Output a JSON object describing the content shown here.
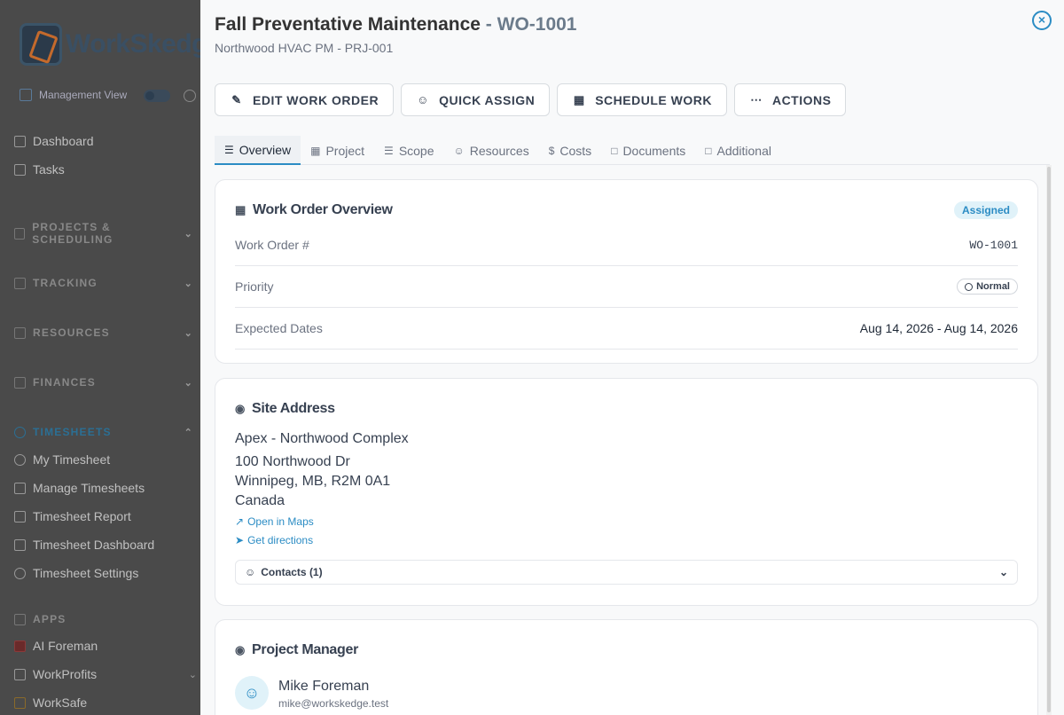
{
  "sidebar": {
    "logo_text": "WorkSkedge",
    "management_view": "Management View",
    "top_items": [
      {
        "label": "Dashboard"
      },
      {
        "label": "Tasks"
      }
    ],
    "sections": [
      {
        "label": "PROJECTS & SCHEDULING"
      },
      {
        "label": "TRACKING"
      },
      {
        "label": "RESOURCES"
      },
      {
        "label": "FINANCES"
      },
      {
        "label": "TIMESHEETS"
      }
    ],
    "timesheet_items": [
      {
        "label": "My Timesheet"
      },
      {
        "label": "Manage Timesheets"
      },
      {
        "label": "Timesheet Report"
      },
      {
        "label": "Timesheet Dashboard"
      },
      {
        "label": "Timesheet Settings"
      }
    ],
    "apps_label": "APPS",
    "app_items": [
      {
        "label": "AI Foreman"
      },
      {
        "label": "WorkProfits"
      },
      {
        "label": "WorkSafe"
      }
    ]
  },
  "header": {
    "title": "Fall Preventative Maintenance",
    "title_sep": " - ",
    "work_order_id": "WO-1001",
    "subtitle": "Northwood HVAC PM - PRJ-001"
  },
  "toolbar": {
    "edit": "EDIT WORK ORDER",
    "quick_assign": "QUICK ASSIGN",
    "schedule": "SCHEDULE WORK",
    "actions": "ACTIONS"
  },
  "tabs": [
    {
      "label": "Overview"
    },
    {
      "label": "Project"
    },
    {
      "label": "Scope"
    },
    {
      "label": "Resources"
    },
    {
      "label": "Costs"
    },
    {
      "label": "Documents"
    },
    {
      "label": "Additional"
    }
  ],
  "overview": {
    "heading": "Work Order Overview",
    "status": "Assigned",
    "work_order_label": "Work Order #",
    "work_order_value": "WO-1001",
    "priority_label": "Priority",
    "priority_value": "Normal",
    "dates_label": "Expected Dates",
    "dates_value": "Aug 14, 2026 - Aug 14, 2026"
  },
  "site": {
    "heading": "Site Address",
    "name": "Apex - Northwood Complex",
    "line1": "100 Northwood Dr",
    "line2": "Winnipeg, MB, R2M 0A1",
    "line3": "Canada",
    "open_maps": "Open in Maps",
    "directions": "Get directions",
    "contacts": "Contacts (1)"
  },
  "manager": {
    "heading": "Project Manager",
    "name": "Mike Foreman",
    "email": "mike@workskedge.test"
  },
  "colors": {
    "accent": "#2b8cc4",
    "overlay": "#4a4a4a"
  }
}
